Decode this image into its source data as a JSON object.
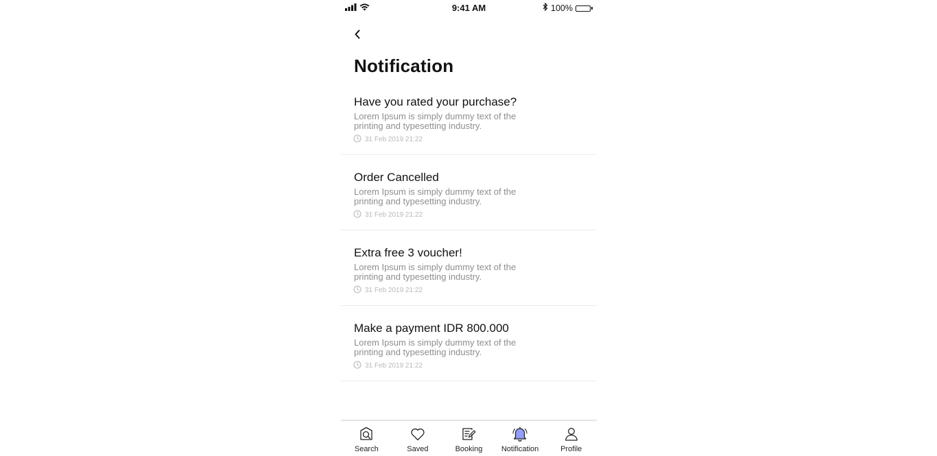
{
  "status_bar": {
    "time": "9:41 AM",
    "battery_text": "100%",
    "icons": [
      "signal-icon",
      "wifi-icon",
      "bluetooth-icon",
      "battery-icon"
    ]
  },
  "header": {
    "back_icon": "chevron-left-icon",
    "title": "Notification"
  },
  "notifications": [
    {
      "title": "Have you rated your purchase?",
      "description": "Lorem Ipsum is simply dummy text of the printing and typesetting industry.",
      "time": "31 Feb 2019 21:22"
    },
    {
      "title": "Order Cancelled",
      "description": "Lorem Ipsum is simply dummy text of the printing and typesetting industry.",
      "time": "31 Feb 2019 21:22"
    },
    {
      "title": "Extra free 3 voucher!",
      "description": "Lorem Ipsum is simply dummy text of the printing and typesetting industry.",
      "time": "31 Feb 2019 21:22"
    },
    {
      "title": "Make a payment IDR 800.000",
      "description": "Lorem Ipsum is simply dummy text of the printing and typesetting industry.",
      "time": "31 Feb 2019 21:22"
    }
  ],
  "tab_bar": {
    "items": [
      {
        "label": "Search",
        "icon": "search-icon",
        "active": false
      },
      {
        "label": "Saved",
        "icon": "heart-icon",
        "active": false
      },
      {
        "label": "Booking",
        "icon": "booking-icon",
        "active": false
      },
      {
        "label": "Notification",
        "icon": "bell-icon",
        "active": true
      },
      {
        "label": "Profile",
        "icon": "profile-icon",
        "active": false
      }
    ],
    "active_color": "#3b4cf5"
  },
  "colors": {
    "text_primary": "#111111",
    "text_secondary": "#8e8e8e",
    "text_muted": "#b8b8b8",
    "divider": "#ececec"
  }
}
